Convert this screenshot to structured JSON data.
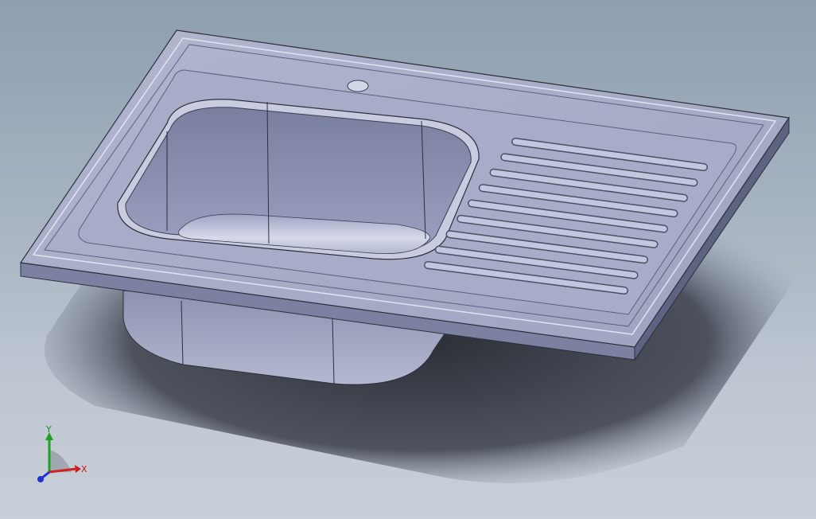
{
  "viewport": {
    "background_top": "#8e9eb0",
    "background_bottom": "#c8cfd8"
  },
  "model": {
    "name": "sink",
    "colors": {
      "top_face": "#a3a8c4",
      "top_face_light": "#b9bdd4",
      "rim_edge": "#d8dbea",
      "side_face": "#6e7390",
      "bowl_wall": "#8a8fb0",
      "bowl_floor": "#c2c6dd",
      "shadow": "#2a2d36",
      "groove": "#7d82a2"
    }
  },
  "triad": {
    "x_label": "X",
    "y_label": "Y",
    "x_color": "#d02020",
    "y_color": "#20a020",
    "z_color": "#2030d0"
  }
}
